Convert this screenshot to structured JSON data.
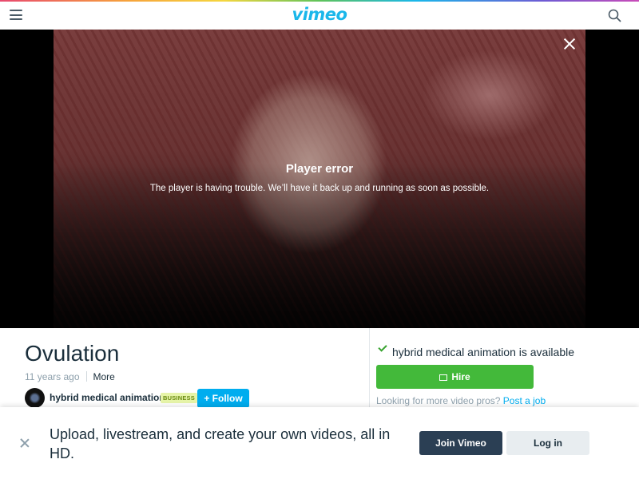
{
  "header": {
    "logo": "vimeo",
    "menu_icon": "hamburger-menu-icon",
    "search_icon": "search-icon"
  },
  "player": {
    "error_title": "Player error",
    "error_message": "The player is having trouble. We’ll have it back up and running as soon as possible."
  },
  "video": {
    "title": "Ovulation",
    "age": "11 years ago",
    "more_label": "More",
    "uploader": "hybrid medical animation",
    "badge": "BUSINESS",
    "follow_label": "+ Follow"
  },
  "hire": {
    "availability": "hybrid medical animation is available",
    "hire_label": "Hire",
    "pros_text": "Looking for more video pros?",
    "post_job_label": "Post a job"
  },
  "banner": {
    "text": "Upload, livestream, and create your own videos, all in HD.",
    "join_label": "Join Vimeo",
    "login_label": "Log in"
  },
  "colors": {
    "brand": "#1ab7ea",
    "follow": "#00adef",
    "hire": "#43b93a",
    "join": "#2b3f54"
  }
}
